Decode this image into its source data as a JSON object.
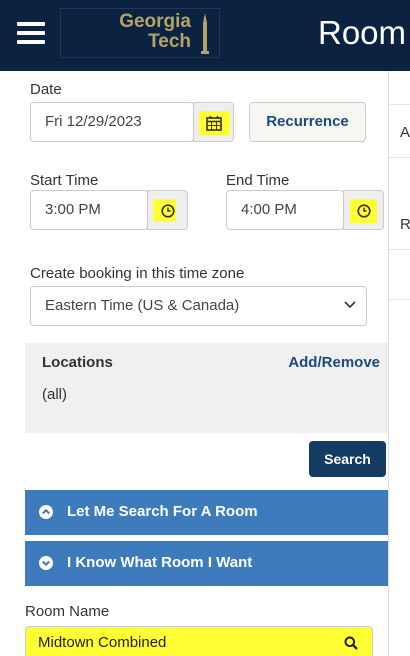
{
  "header": {
    "logo_text_line1": "Georgia",
    "logo_text_line2": "Tech",
    "title": "Room"
  },
  "date": {
    "label": "Date",
    "value": "Fri 12/29/2023",
    "recurrence_label": "Recurrence"
  },
  "start_time": {
    "label": "Start Time",
    "value": "3:00 PM"
  },
  "end_time": {
    "label": "End Time",
    "value": "4:00 PM"
  },
  "timezone": {
    "label": "Create booking in this time zone",
    "selected": "Eastern Time (US & Canada)"
  },
  "locations": {
    "title": "Locations",
    "add_remove": "Add/Remove",
    "value": "(all)"
  },
  "search_button": "Search",
  "accordions": [
    {
      "label": "Let Me Search For A Room",
      "icon": "chevron-up-circle-icon"
    },
    {
      "label": "I Know What Room I Want",
      "icon": "chevron-down-circle-icon"
    }
  ],
  "room_name": {
    "label": "Room Name",
    "value": "Midtown Combined"
  },
  "right_panel": {
    "letter_a": "A",
    "letter_r": "R"
  },
  "colors": {
    "header_bg": "#0b2341",
    "accent_gold": "#b3a369",
    "accordion_blue": "#3e7bbd",
    "button_navy": "#143c63",
    "highlight": "#ffff33"
  }
}
